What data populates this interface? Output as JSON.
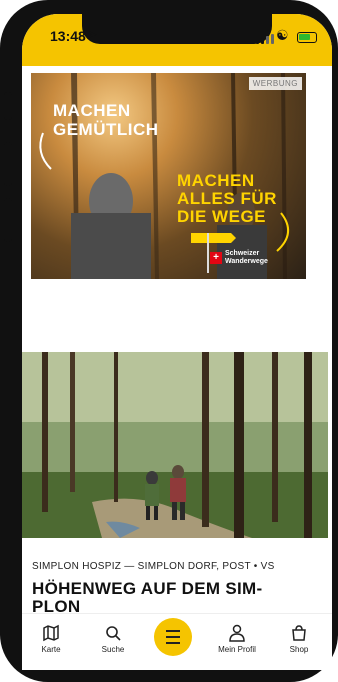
{
  "status_bar": {
    "time": "13:48"
  },
  "ad": {
    "badge": "WERBUNG",
    "headline_1": [
      "MACHEN",
      "GEMÜTLICH"
    ],
    "headline_2": [
      "MACHEN",
      "ALLES FÜR",
      "DIE WEGE"
    ],
    "brand": [
      "Schweizer",
      "Wanderwege"
    ]
  },
  "article": {
    "subtitle": "SIMPLON HOSPIZ — SIMPLON DORF, POST • VS",
    "title": "HÖHENWEG AUF DEM SIM-PLON"
  },
  "tabbar": {
    "items": [
      {
        "label": "Karte",
        "icon": "map-icon"
      },
      {
        "label": "Suche",
        "icon": "search-icon"
      },
      {
        "label": "",
        "icon": "menu-icon"
      },
      {
        "label": "Mein Profil",
        "icon": "profile-icon"
      },
      {
        "label": "Shop",
        "icon": "shop-bag-icon"
      }
    ]
  },
  "colors": {
    "accent": "#f5c400",
    "ad_highlight": "#ffd400",
    "brand_red": "#e30613"
  }
}
